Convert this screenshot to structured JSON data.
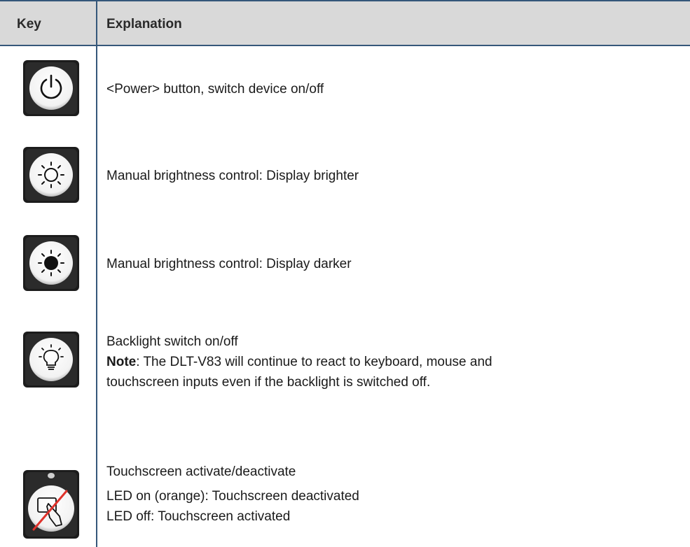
{
  "table": {
    "headers": {
      "key": "Key",
      "explanation": "Explanation"
    },
    "rows": [
      {
        "icon": "power-icon",
        "lines": [
          "<Power> button, switch device on/off"
        ]
      },
      {
        "icon": "brightness-up-icon",
        "lines": [
          "Manual brightness control: Display brighter"
        ]
      },
      {
        "icon": "brightness-down-icon",
        "lines": [
          "Manual brightness control: Display darker"
        ]
      },
      {
        "icon": "backlight-bulb-icon",
        "lines": [
          "Backlight switch on/off"
        ],
        "note_label": "Note",
        "note_text": ": The DLT-V83 will continue to react to keyboard, mouse and",
        "note_text_2": "touchscreen inputs even if the backlight is switched off."
      },
      {
        "icon": "touchscreen-disable-icon",
        "lines": [
          "Touchscreen activate/deactivate",
          "LED on (orange): Touchscreen deactivated",
          "LED off: Touchscreen activated"
        ]
      }
    ]
  },
  "colors": {
    "header_bg": "#d9d9d9",
    "rule": "#35577a",
    "slash": "#e0322b"
  }
}
